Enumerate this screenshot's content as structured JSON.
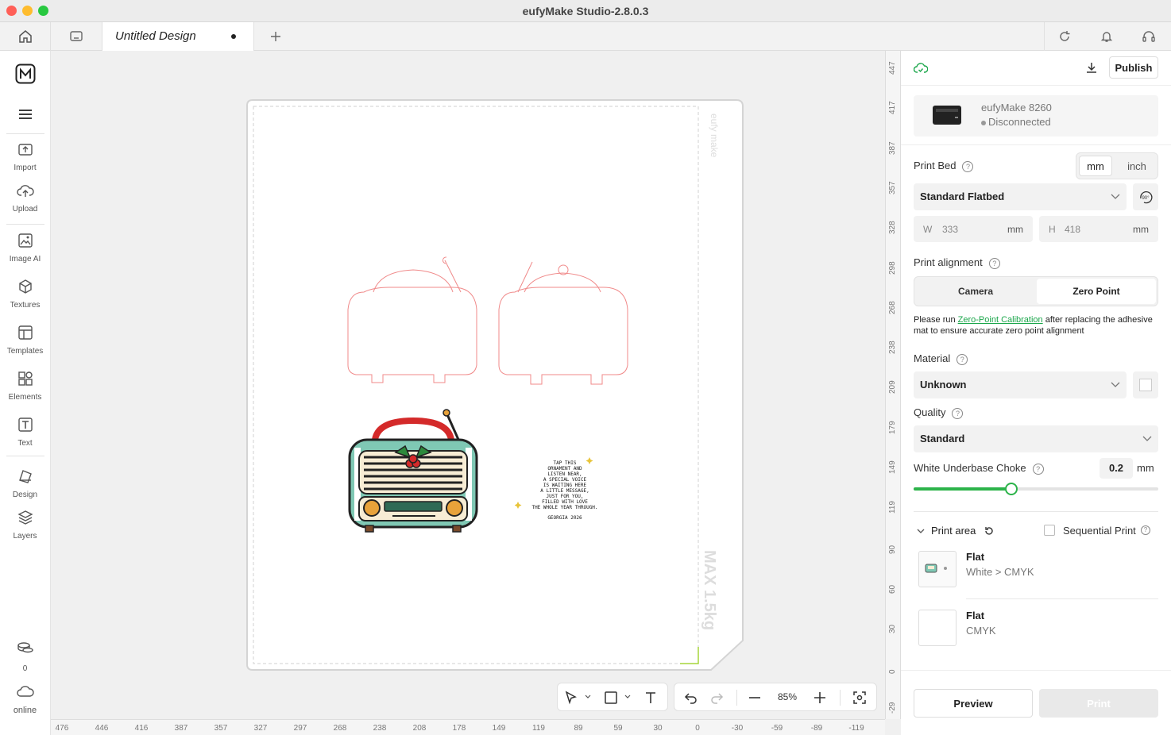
{
  "window": {
    "title": "eufyMake Studio-2.8.0.3"
  },
  "tabs": [
    {
      "label": "Untitled Design"
    }
  ],
  "sidebar": {
    "items": [
      {
        "label": "Import"
      },
      {
        "label": "Upload"
      },
      {
        "label": "Image AI"
      },
      {
        "label": "Textures"
      },
      {
        "label": "Templates"
      },
      {
        "label": "Elements"
      },
      {
        "label": "Text"
      },
      {
        "label": "Design"
      },
      {
        "label": "Layers"
      }
    ],
    "credits": "0",
    "status": "online"
  },
  "bed": {
    "watermark": "eufy make",
    "max_label": "MAX 1.5kg"
  },
  "artwork": {
    "poem": [
      "TAP THIS",
      "ORNAMENT AND",
      "LISTEN NEAR,",
      "A SPECIAL VOICE",
      "IS WAITING HERE",
      "A LITTLE MESSAGE,",
      "JUST FOR YOU,",
      "FILLED WITH LOVE",
      "THE WHOLE YEAR THROUGH."
    ],
    "signature": "GEORGIA 2026"
  },
  "ruler": {
    "h": [
      "476",
      "446",
      "416",
      "387",
      "357",
      "327",
      "297",
      "268",
      "238",
      "208",
      "178",
      "149",
      "119",
      "89",
      "59",
      "30",
      "0",
      "-30",
      "-59",
      "-89",
      "-119"
    ],
    "v": [
      "447",
      "417",
      "387",
      "357",
      "328",
      "298",
      "268",
      "238",
      "209",
      "179",
      "149",
      "119",
      "90",
      "60",
      "30",
      "0",
      "-29"
    ]
  },
  "zoom": {
    "value": "85%"
  },
  "panel": {
    "publish": "Publish",
    "printer": {
      "name": "eufyMake 8260",
      "status": "Disconnected"
    },
    "print_bed": {
      "label": "Print Bed",
      "units": [
        "mm",
        "inch"
      ],
      "selected_unit": "mm",
      "type": "Standard Flatbed",
      "rotate": "90°",
      "w_label": "W",
      "w_value": "333",
      "h_label": "H",
      "h_value": "418",
      "unit": "mm"
    },
    "alignment": {
      "label": "Print alignment",
      "options": [
        "Camera",
        "Zero Point"
      ],
      "selected": "Zero Point",
      "note_pre": "Please run ",
      "note_link": "Zero-Point Calibration",
      "note_post": " after replacing the adhesive mat to ensure accurate zero point alignment"
    },
    "material": {
      "label": "Material",
      "value": "Unknown"
    },
    "quality": {
      "label": "Quality",
      "value": "Standard"
    },
    "choke": {
      "label": "White Underbase Choke",
      "value": "0.2",
      "unit": "mm",
      "fraction": 0.4
    },
    "print_area": {
      "label": "Print area",
      "sequential": "Sequential Print",
      "layers": [
        {
          "title": "Flat",
          "sub": "White > CMYK"
        },
        {
          "title": "Flat",
          "sub": "CMYK"
        }
      ]
    },
    "preview": "Preview",
    "print": "Print"
  },
  "colors": {
    "accent": "#1aa64a",
    "cut_line": "#f08a8a",
    "slider": "#2cb34a"
  }
}
